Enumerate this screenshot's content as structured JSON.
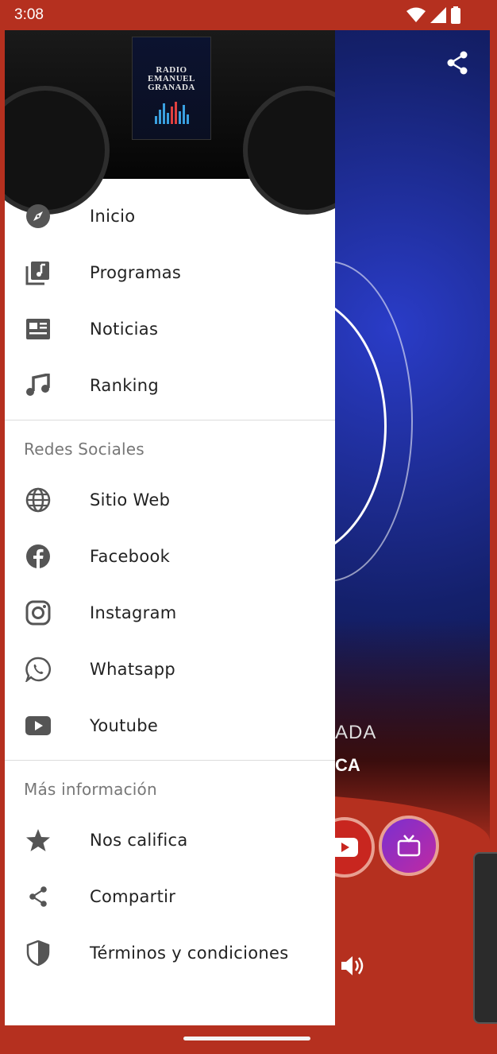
{
  "status_bar": {
    "time": "3:08"
  },
  "drawer": {
    "logo_lines": [
      "RADIO",
      "EMANUEL",
      "GRANADA"
    ],
    "main_items": [
      {
        "label": "Inicio",
        "icon": "compass-icon"
      },
      {
        "label": "Programas",
        "icon": "music-library-icon"
      },
      {
        "label": "Noticias",
        "icon": "newspaper-icon"
      },
      {
        "label": "Ranking",
        "icon": "music-note-icon"
      }
    ],
    "social_title": "Redes Sociales",
    "social_items": [
      {
        "label": "Sitio Web",
        "icon": "globe-icon"
      },
      {
        "label": "Facebook",
        "icon": "facebook-icon"
      },
      {
        "label": "Instagram",
        "icon": "instagram-icon"
      },
      {
        "label": "Whatsapp",
        "icon": "whatsapp-icon"
      },
      {
        "label": "Youtube",
        "icon": "youtube-icon"
      }
    ],
    "info_title": "Más información",
    "info_items": [
      {
        "label": "Nos califica",
        "icon": "star-icon"
      },
      {
        "label": "Compartir",
        "icon": "share-icon"
      },
      {
        "label": "Términos y condiciones",
        "icon": "shield-icon"
      }
    ]
  },
  "background": {
    "partial_title": "ADA",
    "partial_subtitle": "CA"
  },
  "colors": {
    "accent_red": "#b5301f",
    "icon_gray": "#555555"
  }
}
